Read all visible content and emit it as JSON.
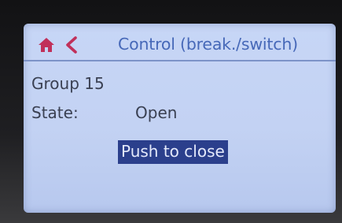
{
  "header": {
    "home_icon": "home-icon",
    "back_icon": "chevron-left-icon",
    "title": "Control (break./switch)"
  },
  "content": {
    "group_label": "Group 15",
    "state_label": "State:",
    "state_value": "Open",
    "action_button": "Push to close"
  },
  "colors": {
    "screen_background": "#c5d4f5",
    "accent": "#4668b8",
    "button_background": "#2b3f8c",
    "button_text": "#e4e9fb",
    "text": "#3a4052"
  }
}
